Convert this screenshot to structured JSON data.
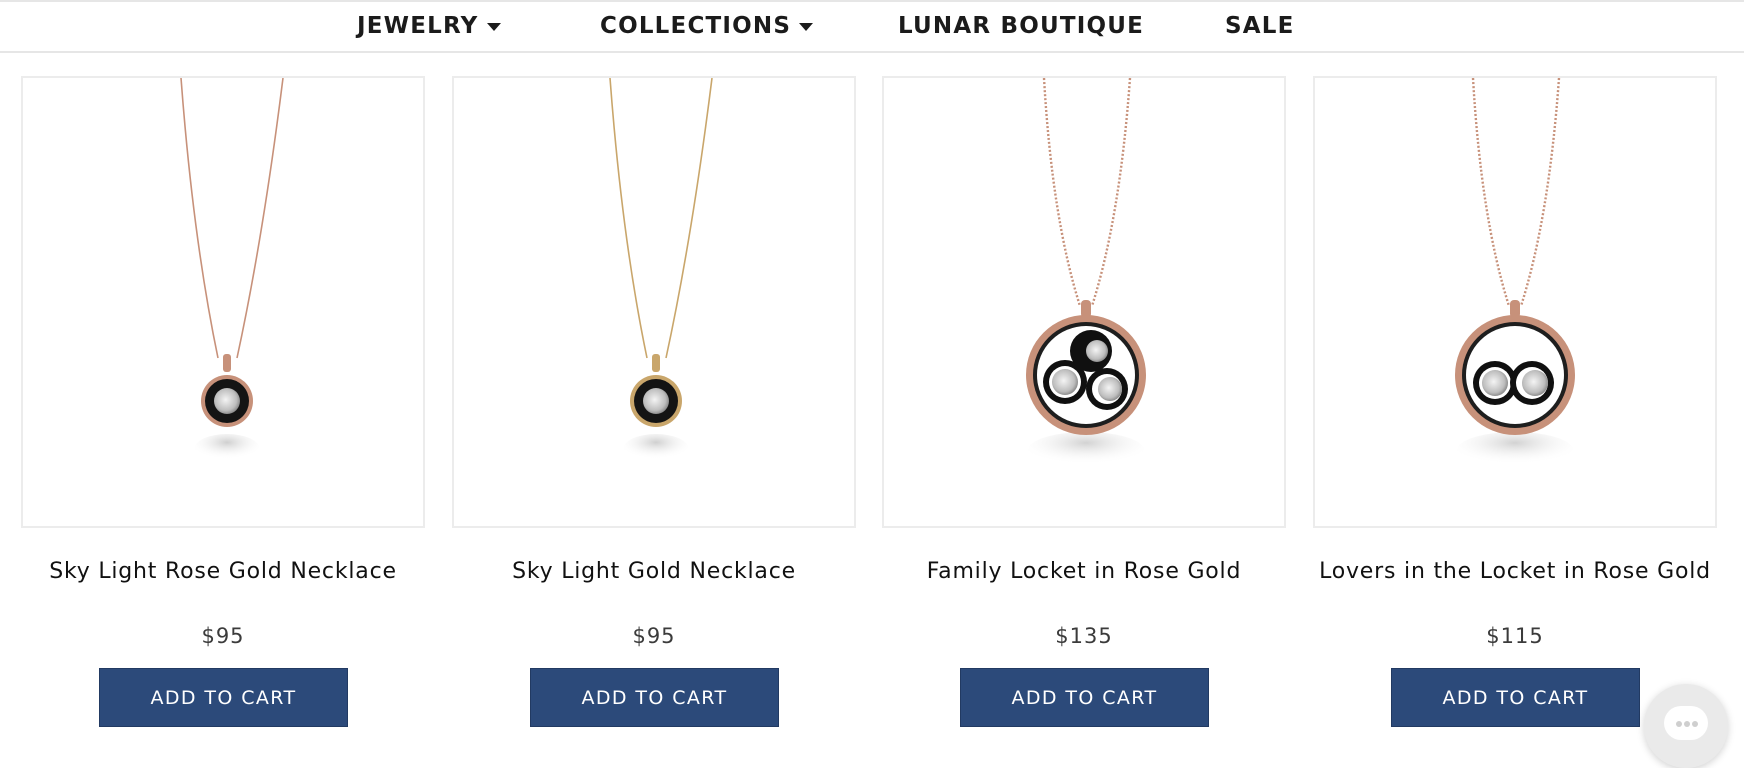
{
  "nav": {
    "items": [
      {
        "label": "JEWELRY",
        "has_dropdown": true
      },
      {
        "label": "COLLECTIONS",
        "has_dropdown": true
      },
      {
        "label": "LUNAR BOUTIQUE",
        "has_dropdown": false
      },
      {
        "label": "SALE",
        "has_dropdown": false
      }
    ]
  },
  "products": [
    {
      "title": "Sky Light Rose Gold Necklace",
      "price": "$95",
      "cta": "ADD TO CART",
      "image": "rose-gold-pendant-single-moon"
    },
    {
      "title": "Sky Light Gold Necklace",
      "price": "$95",
      "cta": "ADD TO CART",
      "image": "gold-pendant-single-moon"
    },
    {
      "title": "Family Locket in Rose Gold",
      "price": "$135",
      "cta": "ADD TO CART",
      "image": "rose-gold-locket-three-moons"
    },
    {
      "title": "Lovers in the Locket in Rose Gold",
      "price": "$115",
      "cta": "ADD TO CART",
      "image": "rose-gold-locket-two-moons"
    }
  ],
  "colors": {
    "button_bg": "#2c4a7a",
    "button_text": "#ffffff",
    "rose_gold": "#c7917a",
    "gold": "#c9a66b"
  },
  "chat_widget": {
    "icon": "chat-bubble-icon"
  }
}
